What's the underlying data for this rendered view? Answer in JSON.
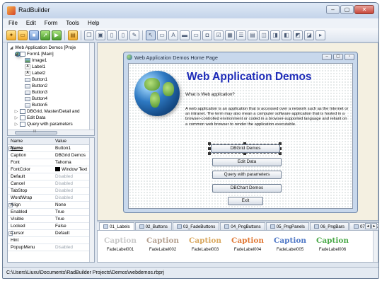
{
  "app": {
    "title": "RadBuilder",
    "min": "–",
    "max": "▢",
    "close": "✕"
  },
  "menu": [
    "File",
    "Edit",
    "Form",
    "Tools",
    "Help"
  ],
  "toolbar_icons": [
    "open-icon",
    "folder-icon",
    "save-icon",
    "publish-icon",
    "run-icon",
    "form-icon",
    "copy-icon",
    "paste-icon",
    "new-page-icon",
    "page-icon",
    "page-edit-icon",
    "pointer-icon",
    "image-tool-icon",
    "label-tool-icon",
    "line-tool-icon",
    "edit-tool-icon",
    "button-tool-icon",
    "checkbox-tool-icon",
    "grid-tool-icon",
    "list-tool-icon",
    "align-left-icon",
    "align-center-icon",
    "align-right-icon",
    "align-top-icon",
    "align-middle-icon",
    "align-bottom-icon"
  ],
  "tree": {
    "root": "Web Application Demos [Proje",
    "form": "Form1 [Main]",
    "children": [
      "Image1",
      "Label1",
      "Label2",
      "Button1",
      "Button2",
      "Button3",
      "Button4",
      "Button5"
    ],
    "others": [
      "DBGrid, Master/Detail and",
      "Edit Data",
      "Query with parameters"
    ],
    "scroll": "III"
  },
  "props": {
    "header": {
      "name": "Name",
      "value": "Value"
    },
    "rows": [
      {
        "name": "Name",
        "value": "Button1"
      },
      {
        "name": "Caption",
        "value": "DBGrid Demos"
      },
      {
        "name": "Font",
        "value": "Tahoma"
      },
      {
        "name": "FontColor",
        "value": "Window Text"
      },
      {
        "name": "Default",
        "value": "Disabled"
      },
      {
        "name": "Cancel",
        "value": "Disabled"
      },
      {
        "name": "TabStop",
        "value": "Disabled"
      },
      {
        "name": "WordWrap",
        "value": "Disabled"
      },
      {
        "name": "Align",
        "value": "None"
      },
      {
        "name": "Enabled",
        "value": "True"
      },
      {
        "name": "Visible",
        "value": "True"
      },
      {
        "name": "Locked",
        "value": "False"
      },
      {
        "name": "Cursor",
        "value": "Default"
      },
      {
        "name": "Hint",
        "value": ""
      },
      {
        "name": "PopupMenu",
        "value": "Disabled"
      }
    ]
  },
  "designer": {
    "title": "Web Application Demos Home Page",
    "headline": "Web Application Demos",
    "subheading": "What is Web application?",
    "paragraph": "A web application is an application that is accessed over a network such as the Internet or an intranet. The term may also mean a computer software application that is hosted in a browser-controlled environment or coded in a browser-supported language and reliant on a common web browser to render the application executable.",
    "buttons": [
      "DBGrid Demos",
      "Edit Data",
      "Query with parameters",
      "DBChart Demos",
      "Exit"
    ]
  },
  "tabs": [
    "01_Labels",
    "02_Buttons",
    "03_FadeButtons",
    "04_PngButtons",
    "05_PngPanels",
    "06_PngBars",
    "07_PngE"
  ],
  "palette": {
    "items": [
      {
        "caption": "Caption",
        "label": "FadeLabel001",
        "color": "#c9c9c9"
      },
      {
        "caption": "Caption",
        "label": "FadeLabel002",
        "color": "#b5a191"
      },
      {
        "caption": "Caption",
        "label": "FadeLabel003",
        "color": "#d9a860"
      },
      {
        "caption": "Caption",
        "label": "FadeLabel004",
        "color": "#e07a38"
      },
      {
        "caption": "Caption",
        "label": "FadeLabel005",
        "color": "#4f78c6"
      },
      {
        "caption": "Caption",
        "label": "FadeLabel006",
        "color": "#4aa948"
      }
    ]
  },
  "status": "C:\\Users\\Liuxu\\Documents\\RadBuilder Projects\\Demos\\webdemos.rbprj"
}
